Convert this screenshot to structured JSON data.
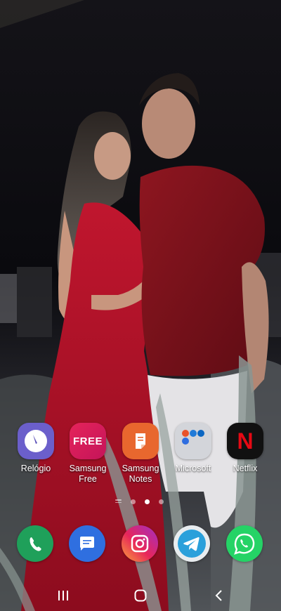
{
  "home": {
    "apps": [
      {
        "label": "Relógio",
        "icon": "clock-icon"
      },
      {
        "label": "Samsung\nFree",
        "icon": "samsung-free-icon",
        "logo_text": "FREE"
      },
      {
        "label": "Samsung\nNotes",
        "icon": "samsung-notes-icon"
      },
      {
        "label": "Microsoft",
        "icon": "microsoft-folder-icon"
      },
      {
        "label": "Netflix",
        "icon": "netflix-icon",
        "logo_text": "N"
      }
    ],
    "page_indicator": {
      "pages": 2,
      "current": 1
    }
  },
  "dock": [
    {
      "name": "phone",
      "icon": "phone-icon",
      "color": "#1fa05a"
    },
    {
      "name": "messages",
      "icon": "messages-icon",
      "color": "#2f6fe0"
    },
    {
      "name": "instagram",
      "icon": "instagram-icon",
      "color": "#d6247b"
    },
    {
      "name": "telegram",
      "icon": "telegram-icon",
      "color": "#2aa0db"
    },
    {
      "name": "whatsapp",
      "icon": "whatsapp-icon",
      "color": "#25d366"
    }
  ],
  "nav": {
    "recents": "recents-icon",
    "home": "home-icon",
    "back": "back-icon"
  },
  "colors": {
    "relogio": "#6b5fcb",
    "samsung_free": "#e0245e",
    "samsung_notes": "#e8672e",
    "netflix_bg": "#111111",
    "netflix_red": "#e50914"
  }
}
